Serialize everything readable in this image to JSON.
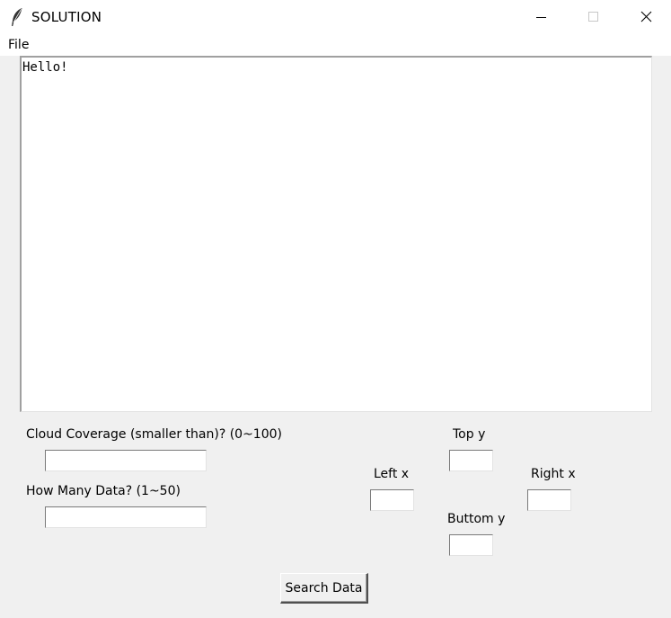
{
  "window": {
    "title": "SOLUTION",
    "icon": "feather-icon",
    "controls": {
      "minimize": "minimize-icon",
      "maximize": "maximize-icon",
      "close": "close-icon"
    }
  },
  "menu": {
    "file_label": "File"
  },
  "output": {
    "text": "Hello!"
  },
  "form": {
    "cloud_label": "Cloud Coverage (smaller than)? (0~100)",
    "cloud_value": "",
    "count_label": "How Many Data? (1~50)",
    "count_value": "",
    "top_y_label": "Top y",
    "top_y_value": "",
    "left_x_label": "Left x",
    "left_x_value": "",
    "right_x_label": "Right x",
    "right_x_value": "",
    "bottom_y_label": "Buttom y",
    "bottom_y_value": "",
    "search_label": "Search Data"
  }
}
